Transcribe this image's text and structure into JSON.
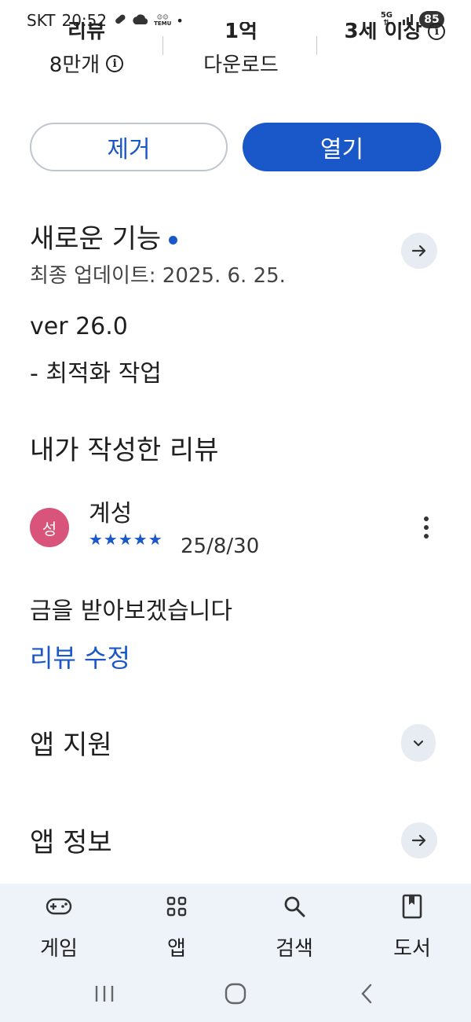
{
  "status_bar": {
    "carrier": "SKT",
    "time": "20:52",
    "temu_label": "TEMU",
    "network": "5G",
    "battery": "85",
    "icons": [
      "link-icon",
      "cloud-icon",
      "temu-app-icon",
      "dot-icon",
      "signal-icon",
      "battery-icon"
    ]
  },
  "stats": [
    {
      "top_cut": "리뷰",
      "label": "8만개",
      "has_info": true
    },
    {
      "top_cut": "1억",
      "label": "다운로드",
      "has_info": false
    },
    {
      "top_cut": "3세 이상",
      "label": "",
      "has_info": true
    }
  ],
  "buttons": {
    "remove": "제거",
    "open": "열기"
  },
  "whats_new": {
    "title": "새로운 기능",
    "last_updated": "최종 업데이트: 2025. 6. 25.",
    "version": "ver 26.0",
    "notes": "- 최적화 작업"
  },
  "my_review": {
    "title": "내가 작성한 리뷰",
    "avatar_initial": "성",
    "reviewer": "계성",
    "stars": "★★★★★",
    "rating": 5,
    "date": "25/8/30",
    "text": "금을 받아보겠습니다",
    "edit_link": "리뷰 수정"
  },
  "app_support": {
    "title": "앱 지원"
  },
  "app_info": {
    "title": "앱 정보"
  },
  "bottom_nav": [
    {
      "label": "게임",
      "icon": "gamepad-icon"
    },
    {
      "label": "앱",
      "icon": "apps-grid-icon"
    },
    {
      "label": "검색",
      "icon": "search-icon"
    },
    {
      "label": "도서",
      "icon": "book-icon"
    }
  ],
  "colors": {
    "accent": "#1a57c9",
    "avatar": "#d8547a",
    "nav_bg": "#eef2f9",
    "chip_bg": "#e7ebf2"
  }
}
